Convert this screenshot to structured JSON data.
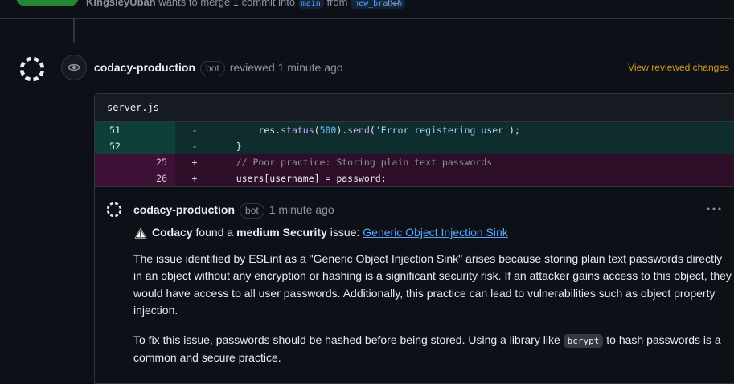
{
  "header": {
    "author": "KingsleyUbah",
    "merge_text": "wants to merge 1 commit into",
    "base_branch": "main",
    "from_text": "from",
    "head_branch": "new_branch"
  },
  "review": {
    "actor": "codacy-production",
    "bot_label": "bot",
    "action": "reviewed 1 minute ago",
    "view_changes": "View reviewed changes"
  },
  "file": {
    "name": "server.js",
    "lines": [
      {
        "old": "51",
        "new": "",
        "sign": "-",
        "type": "del"
      },
      {
        "old": "52",
        "new": "",
        "sign": "-",
        "type": "del"
      },
      {
        "old": "",
        "new": "25",
        "sign": "+",
        "type": "add"
      },
      {
        "old": "",
        "new": "26",
        "sign": "+",
        "type": "add"
      }
    ],
    "code": {
      "l1_indent": "        ",
      "l1_obj": "res.",
      "l1_fn1": "status",
      "l1_p1": "(",
      "l1_num": "500",
      "l1_p2": ").",
      "l1_fn2": "send",
      "l1_p3": "(",
      "l1_str": "'Error registering user'",
      "l1_end": ");",
      "l2": "    }",
      "l3": "    // Poor practice: Storing plain text passwords",
      "l4": "    users[username] = password;"
    }
  },
  "comment": {
    "actor": "codacy-production",
    "bot_label": "bot",
    "time": "1 minute ago",
    "found_brand": "Codacy",
    "found_text": "found a",
    "severity": "medium Security",
    "issue_text": "issue:",
    "issue_link": "Generic Object Injection Sink",
    "para1": "The issue identified by ESLint as a \"Generic Object Injection Sink\" arises because storing plain text passwords directly in an object without any encryption or hashing is a significant security risk. If an attacker gains access to this object, they would have access to all user passwords. Additionally, this practice can lead to vulnerabilities such as object property injection.",
    "para2_before": "To fix this issue, passwords should be hashed before being stored. Using a library like",
    "para2_code": "bcrypt",
    "para2_after": "to hash passwords is a common and secure practice."
  },
  "colors": {
    "accent_link": "#58a6ff",
    "view_changes": "#d29922",
    "merge_green": "#238636",
    "deletion_bg": "#0f2d2c",
    "addition_bg": "#2f0e2a"
  },
  "icons": [
    "copy-icon",
    "codacy-logo-icon",
    "eye-icon",
    "warning-icon",
    "kebab-menu-icon"
  ]
}
